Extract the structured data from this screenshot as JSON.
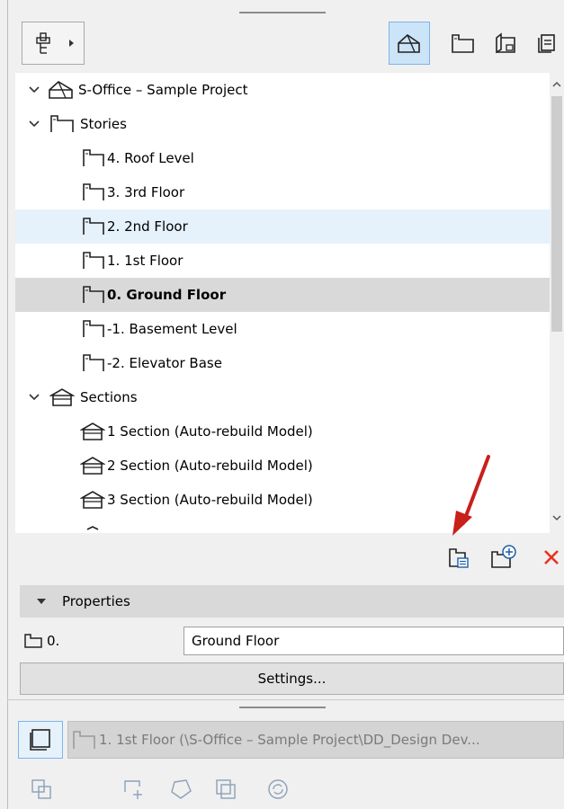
{
  "tree": {
    "project": "S-Office – Sample Project",
    "stories_label": "Stories",
    "stories": [
      {
        "label": "4. Roof Level",
        "state": "normal"
      },
      {
        "label": "3. 3rd Floor",
        "state": "normal"
      },
      {
        "label": "2. 2nd Floor",
        "state": "hover"
      },
      {
        "label": "1. 1st Floor",
        "state": "normal"
      },
      {
        "label": "0. Ground Floor",
        "state": "selected"
      },
      {
        "label": "-1. Basement Level",
        "state": "normal"
      },
      {
        "label": "-2. Elevator Base",
        "state": "normal"
      }
    ],
    "sections_label": "Sections",
    "sections": [
      {
        "label": "1 Section (Auto-rebuild Model)"
      },
      {
        "label": "2 Section (Auto-rebuild Model)"
      },
      {
        "label": "3 Section (Auto-rebuild Model)"
      }
    ]
  },
  "properties": {
    "header": "Properties",
    "id_value": "0.",
    "name_value": "Ground Floor",
    "settings_label": "Settings..."
  },
  "bottom": {
    "path_text": "1. 1st Floor (\\S-Office – Sample Project\\DD_Design Dev..."
  },
  "icons": [
    "view-map-icon",
    "project-map-icon",
    "layout-book-icon",
    "publisher-sets-icon",
    "new-independent-view-icon",
    "add-view-icon",
    "delete-icon",
    "annotation-arrow"
  ],
  "colors": {
    "accent": "#cce4f7",
    "hover": "#e5f1fb",
    "selected": "#d9d9d9",
    "delete": "#e8321e",
    "arrow": "#c8201a"
  }
}
